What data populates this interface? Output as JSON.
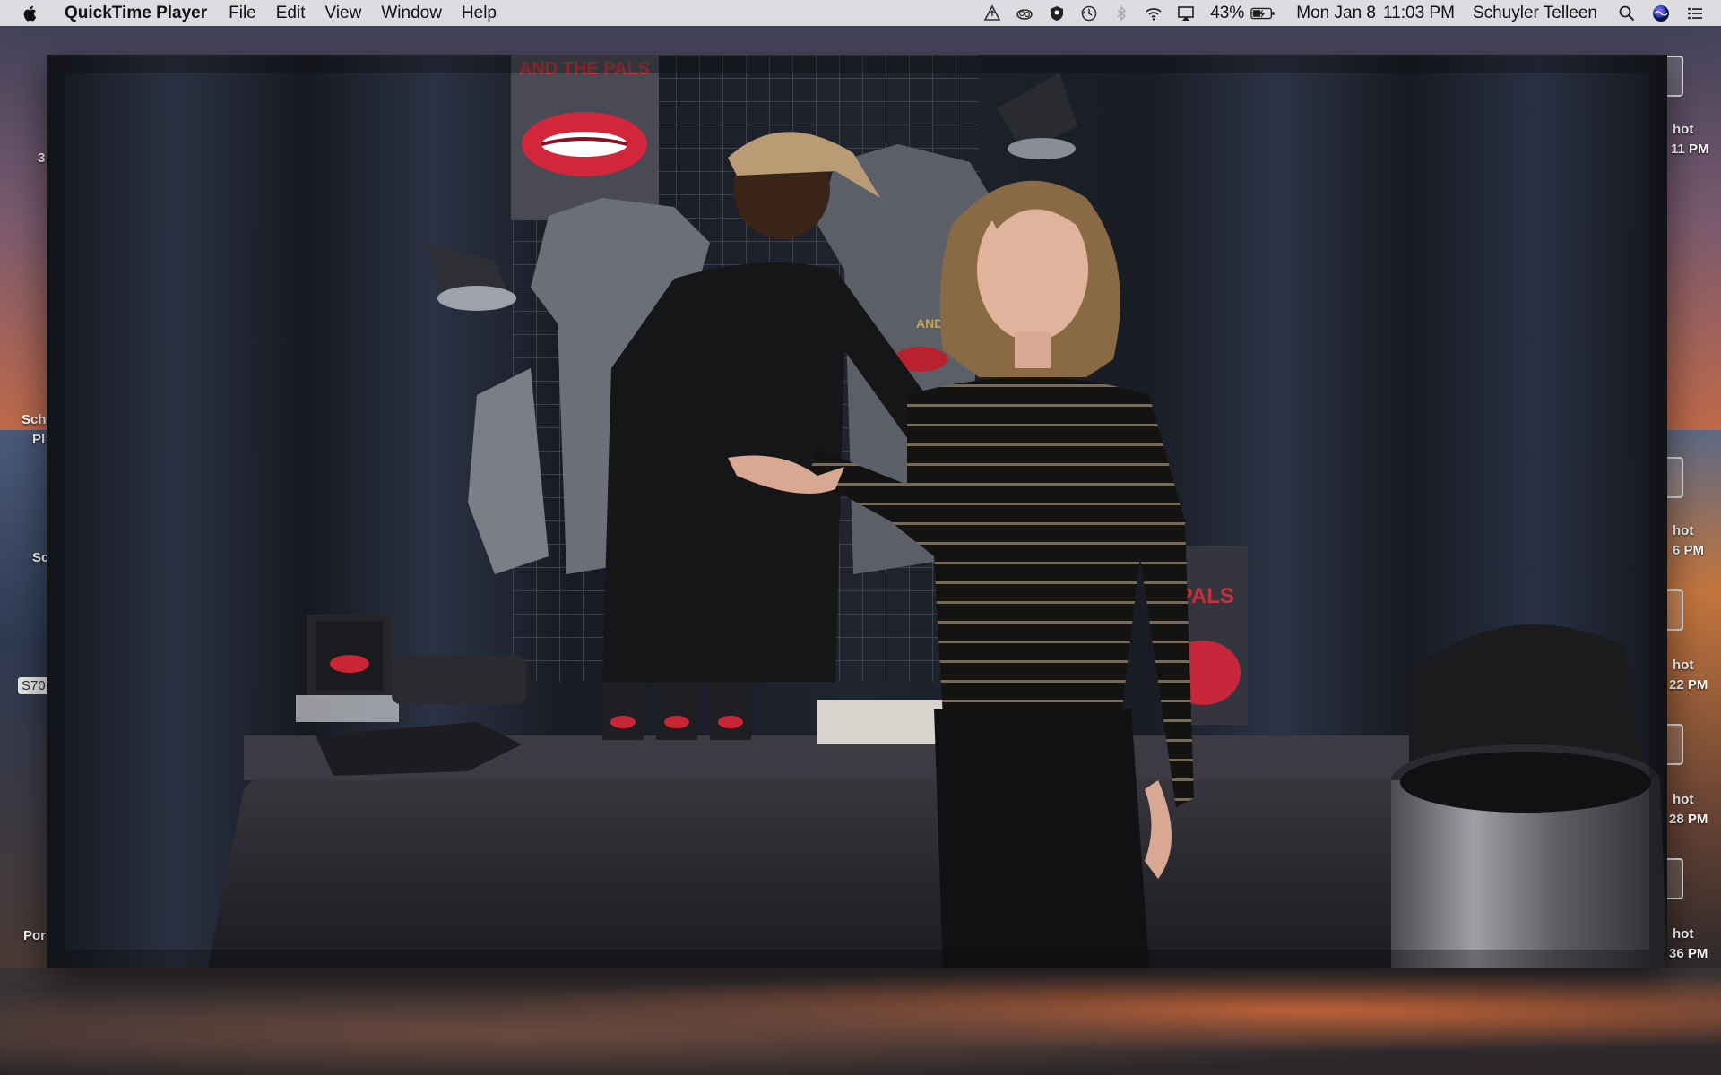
{
  "menubar": {
    "app_name": "QuickTime Player",
    "menus": [
      "File",
      "Edit",
      "View",
      "Window",
      "Help"
    ],
    "battery": "43%",
    "date": "Mon Jan 8",
    "time": "11:03 PM",
    "user": "Schuyler Telleen"
  },
  "desktop": {
    "labels_left": [
      "3",
      "Sch",
      "Pl",
      "Sc",
      "Por"
    ],
    "tag_left": "S70",
    "labels_right": [
      "hot",
      "11 PM",
      "hot",
      "6 PM",
      "hot",
      "22 PM",
      "hot",
      "28 PM",
      "hot",
      "36 PM"
    ]
  },
  "video": {
    "poster_title": "AND THE PALS",
    "banner_text": "E PALS",
    "merch_text": "AND THE PALS"
  },
  "colors": {
    "menubar_bg": "#ECE9EC",
    "curtain": "#1f2330",
    "table_cloth": "#2b2830",
    "lips_red": "#d2263a"
  }
}
